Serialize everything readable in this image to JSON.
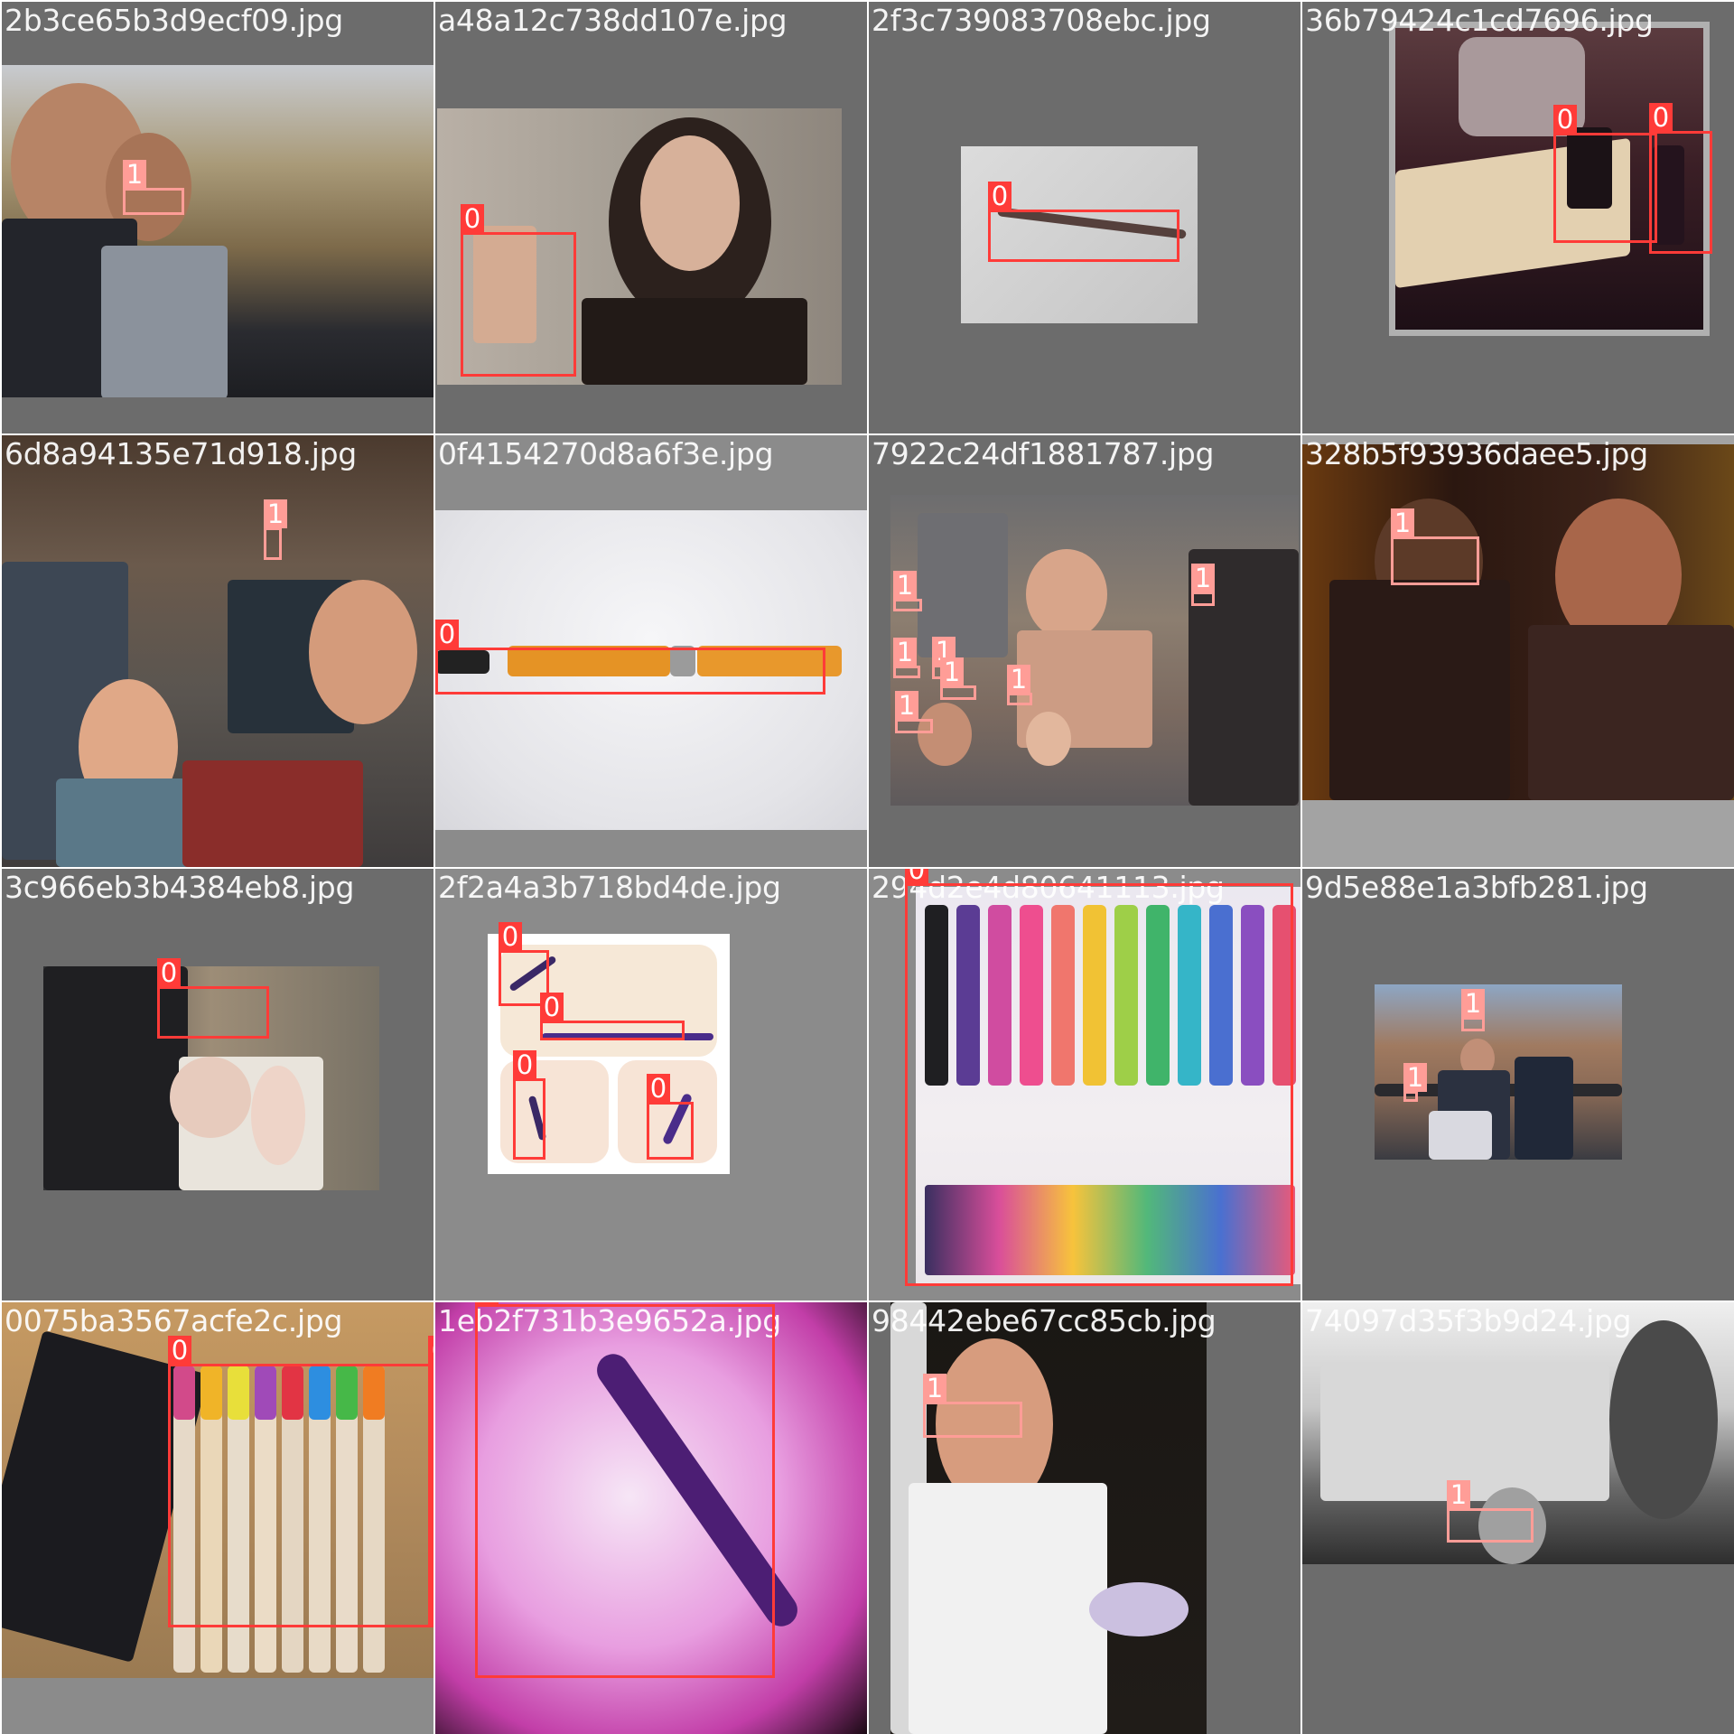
{
  "class_colors": {
    "0": "#ff3b38",
    "1": "#ff9d97"
  },
  "tiles": [
    {
      "filename": "2b3ce65b3d9ecf09.jpg",
      "boxes": [
        {
          "label": "1"
        }
      ]
    },
    {
      "filename": "a48a12c738dd107e.jpg",
      "boxes": [
        {
          "label": "0"
        }
      ]
    },
    {
      "filename": "2f3c739083708ebc.jpg",
      "boxes": [
        {
          "label": "0"
        }
      ]
    },
    {
      "filename": "36b79424c1cd7696.jpg",
      "boxes": [
        {
          "label": "0"
        },
        {
          "label": "0"
        }
      ]
    },
    {
      "filename": "6d8a94135e71d918.jpg",
      "boxes": [
        {
          "label": "1"
        }
      ]
    },
    {
      "filename": "0f4154270d8a6f3e.jpg",
      "boxes": [
        {
          "label": "0"
        }
      ]
    },
    {
      "filename": "7922c24df1881787.jpg",
      "boxes": [
        {
          "label": "1"
        },
        {
          "label": "1"
        },
        {
          "label": "1"
        },
        {
          "label": "1"
        },
        {
          "label": "1"
        },
        {
          "label": "1"
        },
        {
          "label": "1"
        }
      ]
    },
    {
      "filename": "328b5f93936daee5.jpg",
      "boxes": [
        {
          "label": "1"
        }
      ]
    },
    {
      "filename": "3c966eb3b4384eb8.jpg",
      "boxes": [
        {
          "label": "0"
        }
      ]
    },
    {
      "filename": "2f2a4a3b718bd4de.jpg",
      "boxes": [
        {
          "label": "0"
        },
        {
          "label": "0"
        },
        {
          "label": "0"
        },
        {
          "label": "0"
        }
      ]
    },
    {
      "filename": "294d2e4d80641113.jpg",
      "boxes": [
        {
          "label": "0"
        }
      ]
    },
    {
      "filename": "9d5e88e1a3bfb281.jpg",
      "boxes": [
        {
          "label": "1"
        },
        {
          "label": "1"
        }
      ]
    },
    {
      "filename": "0075ba3567acfe2c.jpg",
      "boxes": [
        {
          "label": "0"
        },
        {
          "label": "0"
        }
      ]
    },
    {
      "filename": "1eb2f731b3e9652a.jpg",
      "boxes": [
        {
          "label": "0"
        }
      ]
    },
    {
      "filename": "98442ebe67cc85cb.jpg",
      "boxes": [
        {
          "label": "1"
        }
      ]
    },
    {
      "filename": "74097d35f3b9d24.jpg",
      "boxes": [
        {
          "label": "1"
        }
      ]
    }
  ]
}
